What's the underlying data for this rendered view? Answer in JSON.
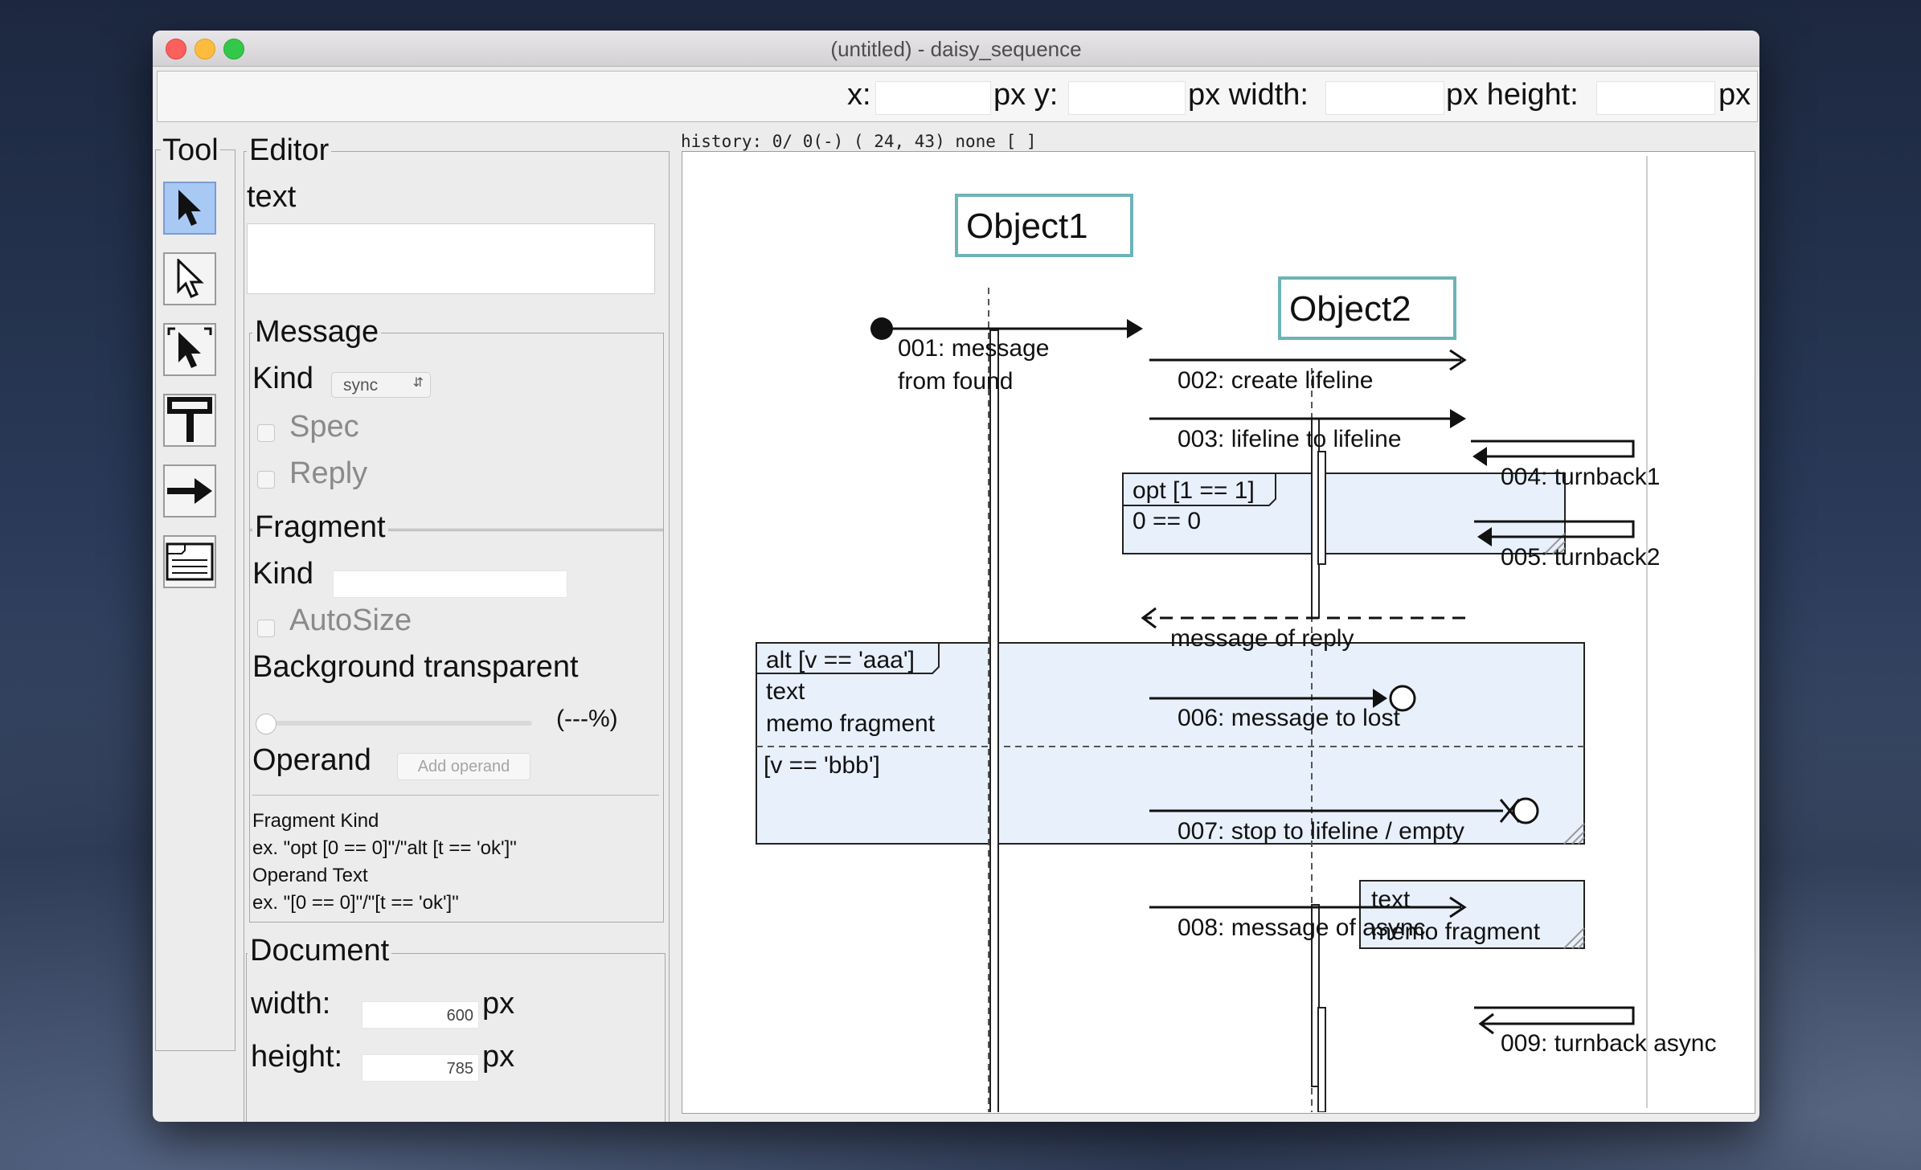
{
  "window": {
    "title": "(untitled) - daisy_sequence"
  },
  "coordbar": {
    "x_label": "x:",
    "y_label": "px y:",
    "width_label": "px width:",
    "height_label": "px height:",
    "px_label": "px"
  },
  "tools": {
    "title": "Tool",
    "items": [
      {
        "name": "select-tool-icon",
        "selected": true
      },
      {
        "name": "select-outline-tool-icon",
        "selected": false
      },
      {
        "name": "select-bracket-tool-icon",
        "selected": false
      },
      {
        "name": "lifeline-tool-icon",
        "selected": false
      },
      {
        "name": "message-tool-icon",
        "selected": false
      },
      {
        "name": "fragment-tool-icon",
        "selected": false
      }
    ]
  },
  "editor": {
    "title": "Editor",
    "text_label": "text",
    "text_value": "",
    "message": {
      "title": "Message",
      "kind_label": "Kind",
      "kind_value": "sync",
      "spec_label": "Spec",
      "reply_label": "Reply"
    },
    "fragment": {
      "title": "Fragment",
      "kind_label": "Kind",
      "autosize_label": "AutoSize",
      "bg_label": "Background transparent",
      "bg_percent": "(---%)",
      "operand_label": "Operand",
      "add_operand": "Add operand",
      "help": [
        "Fragment Kind",
        "ex. \"opt [0 == 0]\"/\"alt [t == 'ok']\"",
        "Operand Text",
        "ex. \"[0 == 0]\"/\"[t == 'ok']\""
      ]
    },
    "document": {
      "title": "Document",
      "width_label": "width:",
      "width_value": "600",
      "height_label": "height:",
      "height_value": "785",
      "px": "px"
    }
  },
  "history": "history: 0/ 0(-) ( 24, 43) none [ ]",
  "diagram": {
    "lifelines": [
      "Object1",
      "Object2"
    ],
    "messages": [
      "001: message",
      "from found",
      "002: create lifeline",
      "003: lifeline to lifeline",
      "004: turnback1",
      "005: turnback2",
      "message of reply",
      "006: message to lost",
      "007: stop to lifeline / empty",
      "008: message of async",
      "009: turnback async"
    ],
    "fragments": {
      "opt_title": "opt [1 == 1]",
      "opt_operand": "0 == 0",
      "alt_title": "alt [v == 'aaa']",
      "alt_text1": "text",
      "alt_text2": "memo fragment",
      "alt_operand2": "[v == 'bbb']",
      "memo_line1": "text",
      "memo_line2": "memo fragment"
    },
    "colors": {
      "lifeline_border": "#6db3b8",
      "fragment_fill": "#e8f0fc"
    }
  }
}
